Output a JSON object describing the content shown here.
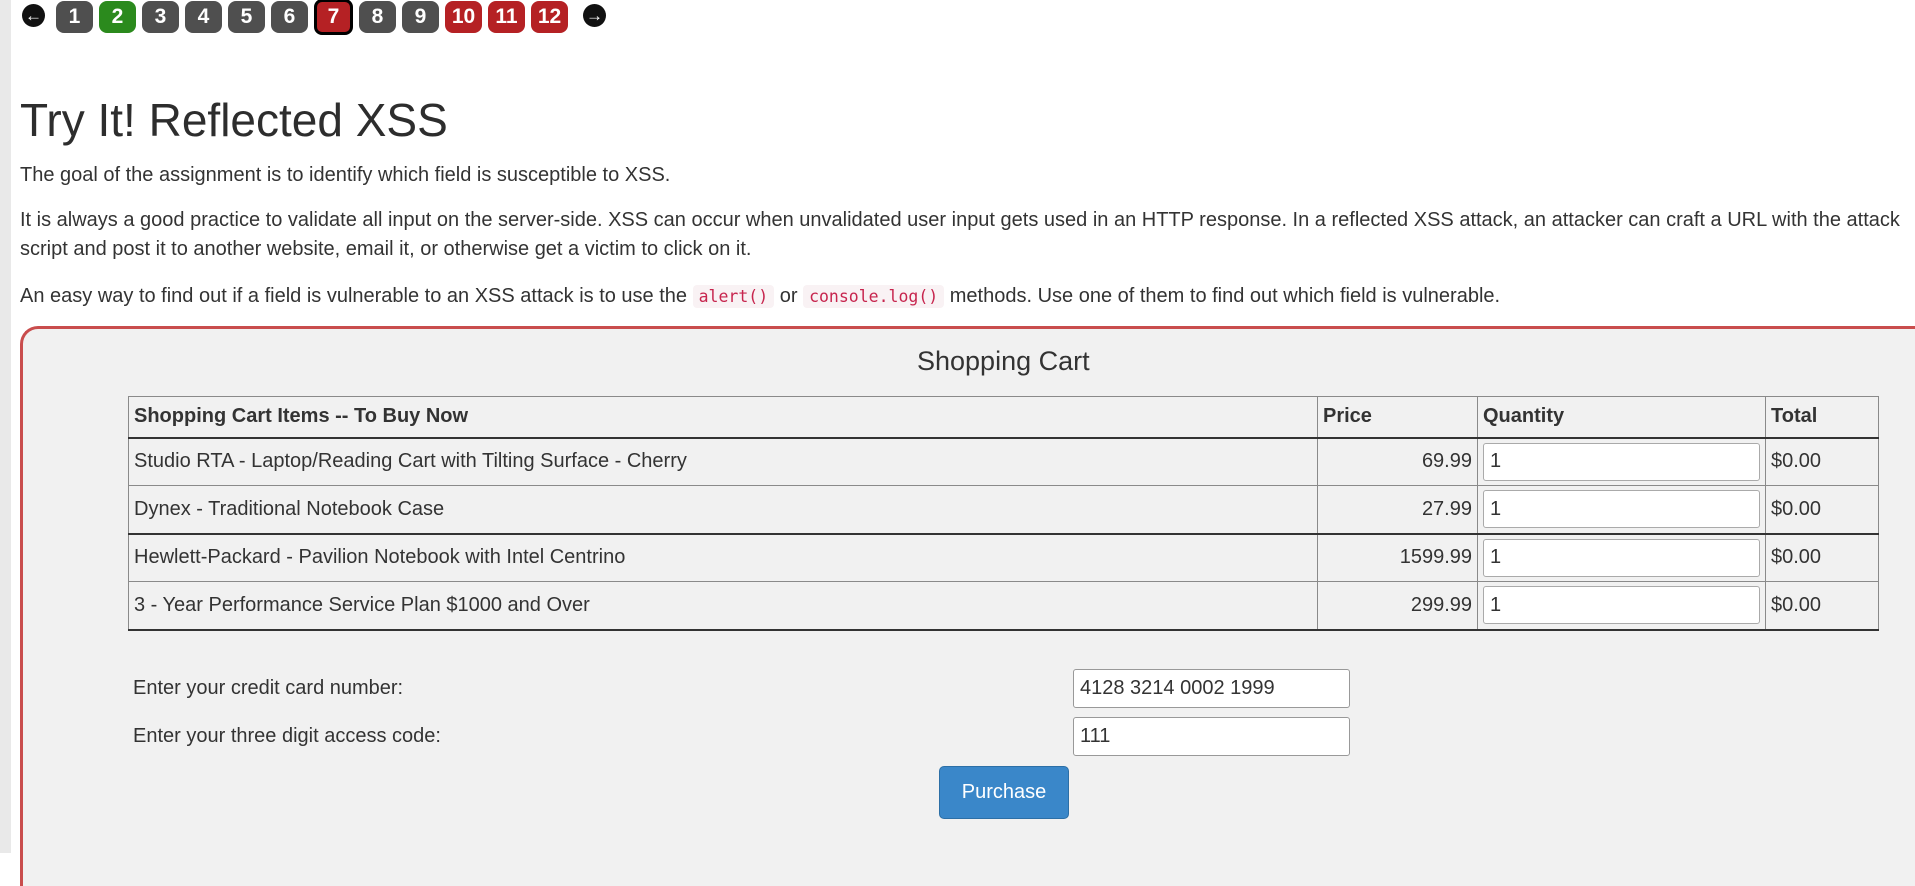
{
  "pager": {
    "prev_icon": "arrow-left-icon",
    "next_icon": "arrow-right-icon",
    "pages": [
      {
        "label": "1",
        "state": "gray"
      },
      {
        "label": "2",
        "state": "green"
      },
      {
        "label": "3",
        "state": "gray"
      },
      {
        "label": "4",
        "state": "gray"
      },
      {
        "label": "5",
        "state": "gray"
      },
      {
        "label": "6",
        "state": "gray"
      },
      {
        "label": "7",
        "state": "current"
      },
      {
        "label": "8",
        "state": "gray"
      },
      {
        "label": "9",
        "state": "gray"
      },
      {
        "label": "10",
        "state": "red"
      },
      {
        "label": "11",
        "state": "red"
      },
      {
        "label": "12",
        "state": "red"
      }
    ],
    "colors": {
      "gray": "#4f4f4f",
      "green": "#2b8a1d",
      "red": "#b52124"
    }
  },
  "content": {
    "title": "Try It! Reflected XSS",
    "p1": "The goal of the assignment is to identify which field is susceptible to XSS.",
    "p2": "It is always a good practice to validate all input on the server-side. XSS can occur when unvalidated user input gets used in an HTTP response. In a reflected XSS attack, an attacker can craft a URL with the attack script and post it to another website, email it, or otherwise get a victim to click on it.",
    "p3_before": "An easy way to find out if a field is vulnerable to an XSS attack is to use the ",
    "p3_code1": "alert()",
    "p3_or": " or ",
    "p3_code2": "console.log()",
    "p3_after": " methods. Use one of them to find out which field is vulnerable."
  },
  "cart": {
    "title": "Shopping Cart",
    "headers": {
      "item": "Shopping Cart Items -- To Buy Now",
      "price": "Price",
      "quantity": "Quantity",
      "total": "Total"
    },
    "rows": [
      {
        "item": "Studio RTA - Laptop/Reading Cart with Tilting Surface - Cherry",
        "price": "69.99",
        "quantity": "1",
        "total": "$0.00"
      },
      {
        "item": "Dynex - Traditional Notebook Case",
        "price": "27.99",
        "quantity": "1",
        "total": "$0.00"
      },
      {
        "item": "Hewlett-Packard - Pavilion Notebook with Intel Centrino",
        "price": "1599.99",
        "quantity": "1",
        "total": "$0.00"
      },
      {
        "item": "3 - Year Performance Service Plan $1000 and Over",
        "price": "299.99",
        "quantity": "1",
        "total": "$0.00"
      }
    ]
  },
  "form": {
    "card_label": "Enter your credit card number:",
    "card_value": "4128 3214 0002 1999",
    "code_label": "Enter your three digit access code:",
    "code_value": "111",
    "purchase_label": "Purchase"
  }
}
